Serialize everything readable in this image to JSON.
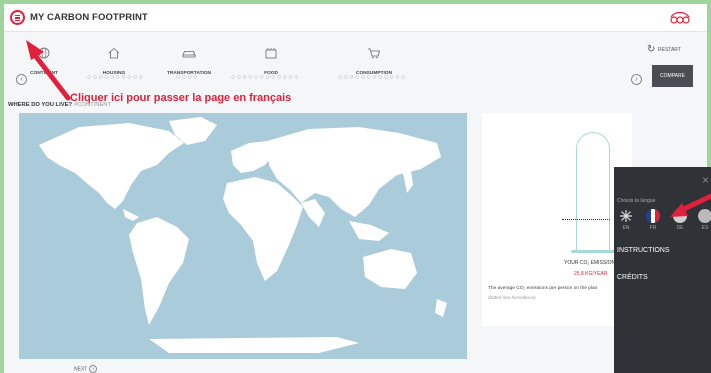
{
  "header": {
    "title": "MY CARBON FOOTPRINT"
  },
  "nav": {
    "steps": [
      {
        "label": "CONTINENT",
        "icon": "globe-icon"
      },
      {
        "label": "HOUSING",
        "icon": "house-icon"
      },
      {
        "label": "TRANSPORTATION",
        "icon": "car-icon"
      },
      {
        "label": "FOOD",
        "icon": "food-icon"
      },
      {
        "label": "CONSUMPTION",
        "icon": "cart-icon"
      }
    ],
    "dots": [
      "○○○○○○○○○○",
      "○○○○",
      "○○○○○○○○○○○○",
      "○○○○○○○○○○○○"
    ],
    "restart_label": "RESTART",
    "compare_label": "COMPARE"
  },
  "annotation": {
    "text": "Cliquer ici pour passer la page en français"
  },
  "question": {
    "text": "WHERE DO YOU LIVE?",
    "tag": "#CONTINENT"
  },
  "result": {
    "label": "YOUR CO₂ EMISSION",
    "value": "25.8 KG/YEAR",
    "average_text": "The average CO₂ emissions per person on the plan",
    "dotted_ref": "dotted line hereabove)"
  },
  "next_label": "NEXT",
  "language_menu": {
    "choose_label": "Choisis ta langue",
    "languages": [
      {
        "code": "EN",
        "icon": "uk-flag-icon"
      },
      {
        "code": "FR",
        "icon": "france-flag-icon"
      },
      {
        "code": "DE",
        "icon": "germany-flag-icon"
      },
      {
        "code": "ES",
        "icon": "spain-flag-icon"
      }
    ],
    "items": [
      "INSTRUCTIONS",
      "CRÉDITS"
    ]
  },
  "colors": {
    "accent": "#e0203c",
    "map_water": "#aacbda",
    "map_land": "#ffffff",
    "outer_border": "#9fd59a",
    "dark_button": "#4a4e54",
    "side_menu": "#2f3236"
  }
}
